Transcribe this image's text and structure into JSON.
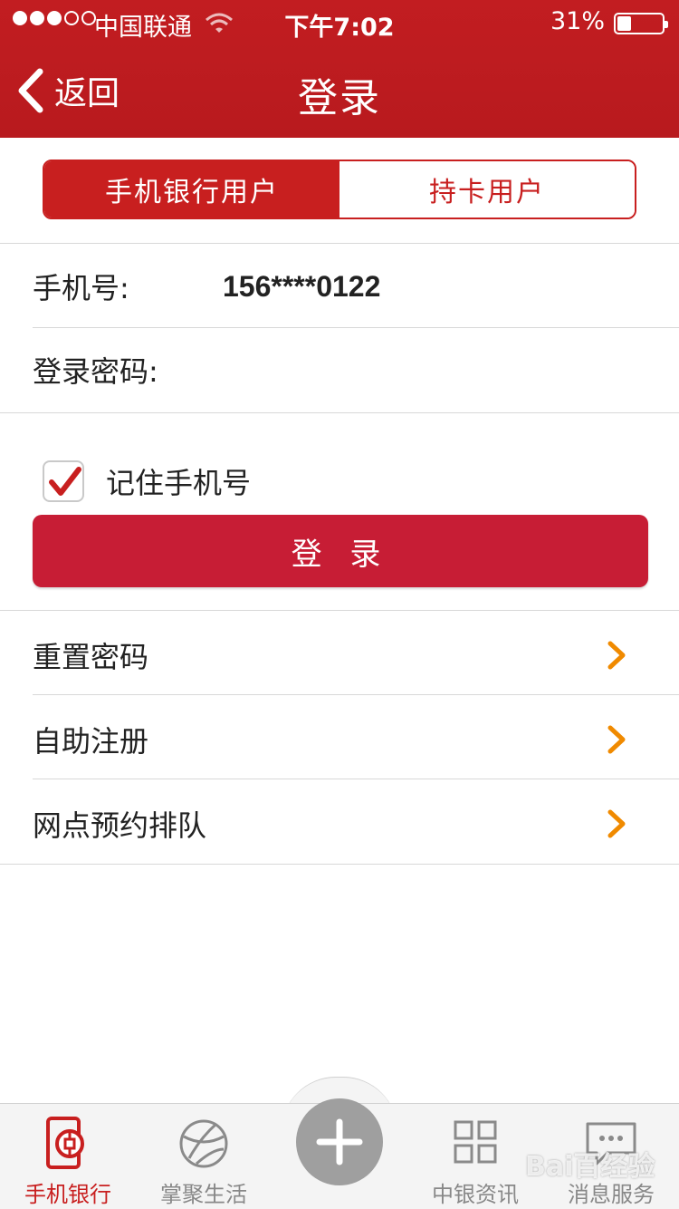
{
  "status_bar": {
    "carrier": "中国联通",
    "time": "下午7:02",
    "battery": "31%",
    "battery_level": 0.31,
    "signal_bars_filled": 3,
    "signal_bars_total": 5
  },
  "nav": {
    "back_label": "返回",
    "title": "登录"
  },
  "segment": {
    "options": [
      "手机银行用户",
      "持卡用户"
    ],
    "selected": "手机银行用户"
  },
  "form": {
    "phone_label": "手机号:",
    "phone_value": "156****0122",
    "password_label": "登录密码:",
    "password_value": "",
    "remember_label": "记住手机号",
    "remember_checked": true,
    "login_button": "登 录"
  },
  "list": {
    "items": [
      {
        "label": "重置密码",
        "icon": "chevron-right-icon"
      },
      {
        "label": "自助注册",
        "icon": "chevron-right-icon"
      },
      {
        "label": "网点预约排队",
        "icon": "chevron-right-icon"
      }
    ]
  },
  "tab_bar": {
    "tabs": [
      {
        "label": "手机银行",
        "icon": "bank-phone-icon",
        "active": true
      },
      {
        "label": "掌聚生活",
        "icon": "globe-icon",
        "active": false
      },
      {
        "label": "",
        "icon": "plus-icon",
        "active": false
      },
      {
        "label": "中银资讯",
        "icon": "grid-icon",
        "active": false
      },
      {
        "label": "消息服务",
        "icon": "chat-icon",
        "active": false
      }
    ]
  },
  "watermark": "Bai百经验",
  "colors": {
    "brand_red": "#c21d21",
    "button_red": "#c71d35",
    "arrow_orange": "#f08a00",
    "tab_inactive": "#888888"
  }
}
